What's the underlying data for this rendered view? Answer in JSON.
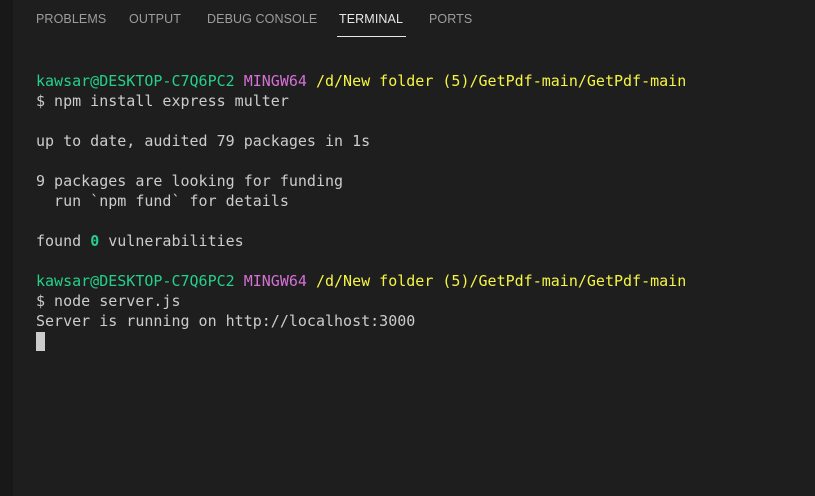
{
  "tabs": [
    {
      "label": "PROBLEMS"
    },
    {
      "label": "OUTPUT"
    },
    {
      "label": "DEBUG CONSOLE"
    },
    {
      "label": "TERMINAL"
    },
    {
      "label": "PORTS"
    }
  ],
  "active_tab": "TERMINAL",
  "colors": {
    "background": "#1e1e1e",
    "text": "#cccccc",
    "user": "#23d18b",
    "system": "#d670d6",
    "path": "#f5f543"
  },
  "terminal": {
    "prompt1": {
      "user": "kawsar@DESKTOP-C7Q6PC2",
      "system": "MINGW64",
      "path": "/d/New folder (5)/GetPdf-main/GetPdf-main"
    },
    "cmd1": "$ npm install express multer",
    "out1": "up to date, audited 79 packages in 1s",
    "out2": "9 packages are looking for funding",
    "out3": "  run `npm fund` for details",
    "out4_prefix": "found ",
    "out4_count": "0",
    "out4_suffix": " vulnerabilities",
    "prompt2": {
      "user": "kawsar@DESKTOP-C7Q6PC2",
      "system": "MINGW64",
      "path": "/d/New folder (5)/GetPdf-main/GetPdf-main"
    },
    "cmd2": "$ node server.js",
    "out5": "Server is running on http://localhost:3000"
  }
}
